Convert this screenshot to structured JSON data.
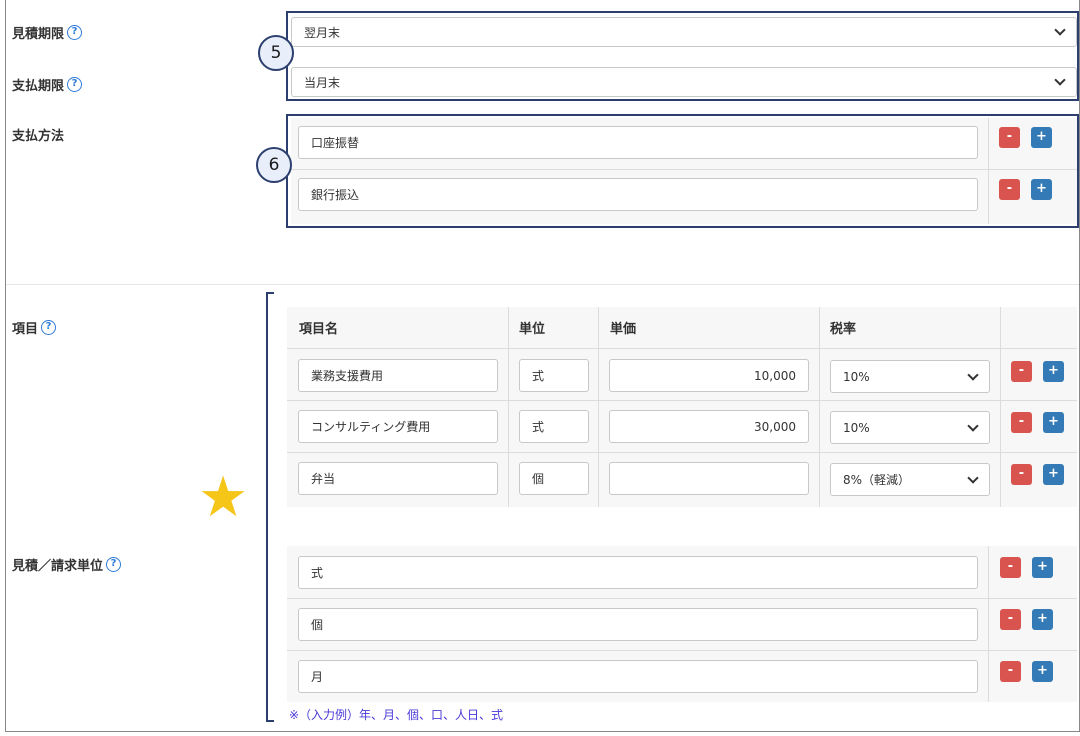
{
  "estimate_deadline": {
    "label": "見積期限",
    "value": "翌月末"
  },
  "payment_deadline": {
    "label": "支払期限",
    "value": "当月末"
  },
  "payment_method": {
    "label": "支払方法",
    "items": [
      "口座振替",
      "銀行振込"
    ]
  },
  "items": {
    "label": "項目",
    "headers": {
      "name": "項目名",
      "unit": "単位",
      "price": "単価",
      "tax": "税率"
    },
    "rows": [
      {
        "name": "業務支援費用",
        "unit": "式",
        "price": "10,000",
        "tax": "10%"
      },
      {
        "name": "コンサルティング費用",
        "unit": "式",
        "price": "30,000",
        "tax": "10%"
      },
      {
        "name": "弁当",
        "unit": "個",
        "price": "",
        "tax": "8%（軽減）"
      }
    ]
  },
  "units": {
    "label": "見積／請求単位",
    "items": [
      "式",
      "個",
      "月"
    ],
    "note": "※（入力例）年、月、個、口、人日、式"
  },
  "callouts": {
    "five": "5",
    "six": "6",
    "star": "★"
  },
  "buttons": {
    "minus": "-",
    "plus": "+"
  },
  "help_icon": "?",
  "colors": {
    "minus": "#d9534f",
    "plus": "#337ab7",
    "callout": "#2c3f6e",
    "help": "#2f7bd8",
    "star": "#f5c518"
  }
}
